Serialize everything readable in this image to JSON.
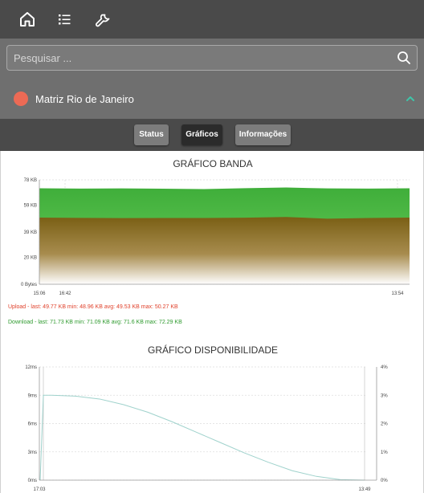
{
  "nav": {
    "icons": [
      "home-icon",
      "list-icon",
      "wrench-icon"
    ]
  },
  "search": {
    "placeholder": "Pesquisar ..."
  },
  "site": {
    "name": "Matriz Rio de Janeiro",
    "status_color": "#ec6a55"
  },
  "tabs": {
    "status": "Status",
    "graficos": "Gráficos",
    "informacoes": "Informações",
    "active": "Gráficos"
  },
  "bandwidth": {
    "title": "GRÁFICO BANDA",
    "upload_summary": "Upload - last: 49.77 KB min: 48.96 KB avg: 49.53 KB max: 50.27 KB",
    "download_summary": "Download - last: 71.73 KB min: 71.09 KB avg: 71.6 KB max: 72.29 KB"
  },
  "availability": {
    "title": "GRÁFICO DISPONIBILIDADE"
  },
  "chart_data": [
    {
      "type": "area",
      "title": "GRÁFICO BANDA",
      "y_ticks": [
        "78 KB",
        "59 KB",
        "39 KB",
        "20 KB",
        "0 Bytes"
      ],
      "y_tick_values": [
        78,
        59,
        39,
        20,
        0
      ],
      "x_ticks": [
        "15:06",
        "16:42",
        "13:54"
      ],
      "ylim": [
        0,
        78
      ],
      "grid": true,
      "series": [
        {
          "name": "Upload",
          "color": "#8a6c1a",
          "values": [
            49.77,
            49.6,
            49.4,
            49.5,
            49.53,
            49.7,
            50.27,
            48.96,
            49.5,
            49.77
          ]
        },
        {
          "name": "Download",
          "color": "#3fae3a",
          "values": [
            71.73,
            71.5,
            71.6,
            71.4,
            71.09,
            71.8,
            72.29,
            71.6,
            71.5,
            71.73
          ]
        }
      ]
    },
    {
      "type": "line",
      "title": "GRÁFICO DISPONIBILIDADE",
      "y_ticks_left": [
        "12ms",
        "9ms",
        "6ms",
        "3ms",
        "0ms"
      ],
      "y_tick_values_left": [
        12,
        9,
        6,
        3,
        0
      ],
      "y_ticks_right": [
        "4%",
        "3%",
        "2%",
        "1%",
        "0%"
      ],
      "y_tick_values_right": [
        4,
        3,
        2,
        1,
        0
      ],
      "x_ticks": [
        "17:03",
        "13:49"
      ],
      "ylim_left": [
        0,
        12
      ],
      "ylim_right": [
        0,
        4
      ],
      "grid": true,
      "series": [
        {
          "name": "",
          "color": "#9fd2cc",
          "axis": "left",
          "values": [
            0,
            9,
            9,
            8.9,
            8.6,
            8.0,
            7.2,
            6.2,
            5.1,
            4.0,
            2.9,
            1.9,
            1.0,
            0.4,
            0.05,
            0
          ]
        }
      ]
    }
  ]
}
